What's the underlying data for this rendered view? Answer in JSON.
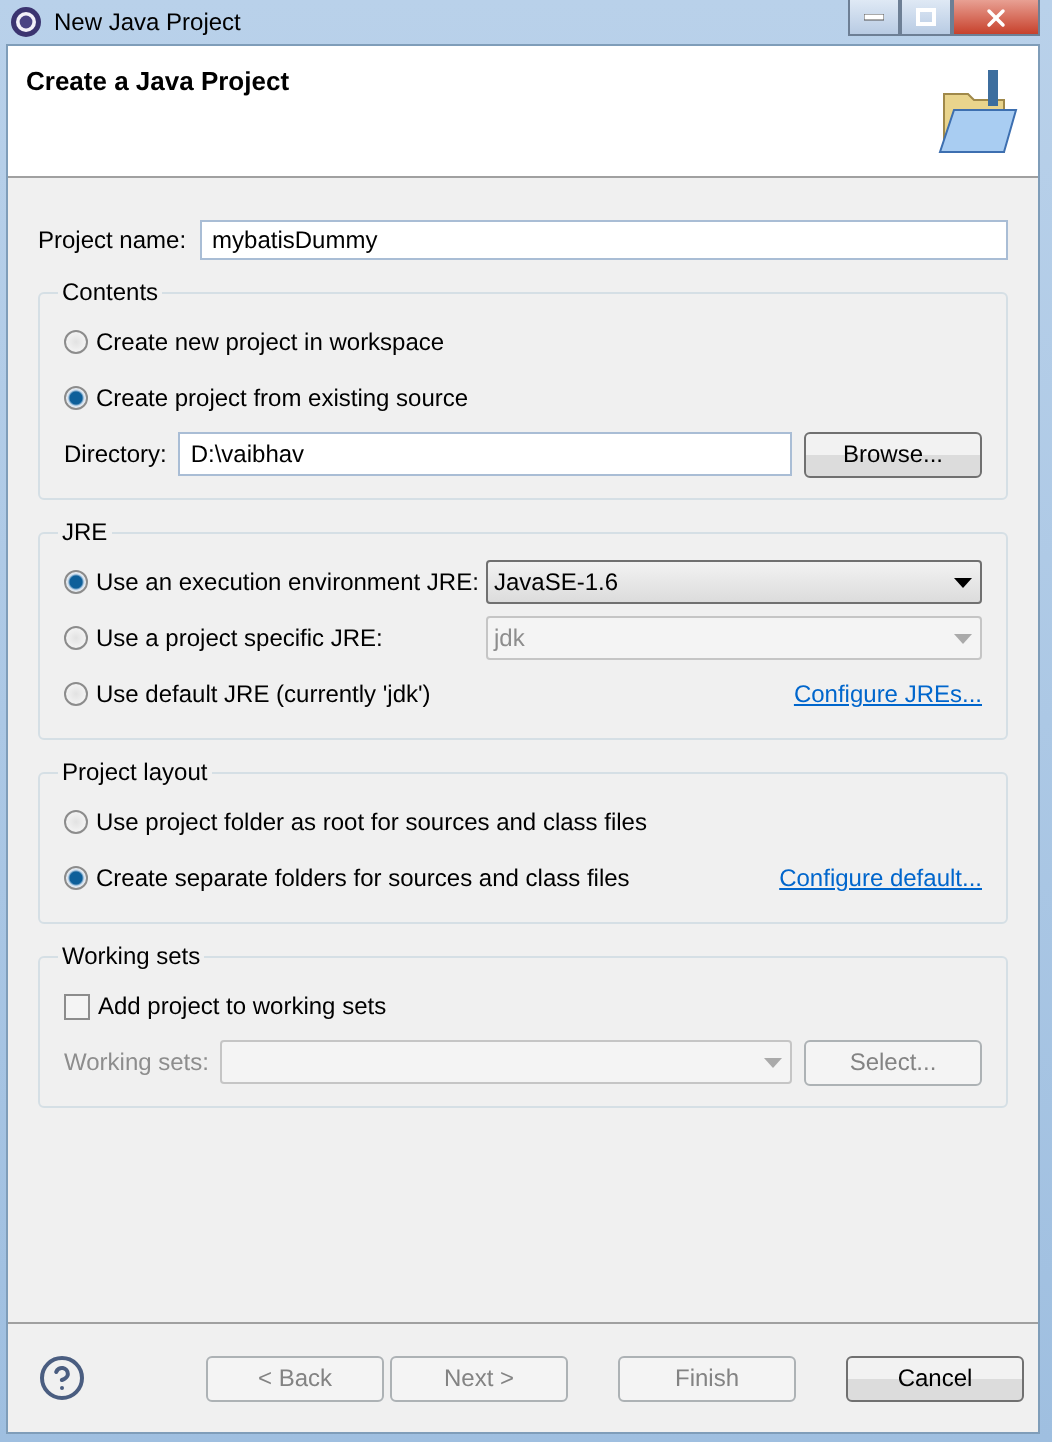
{
  "window": {
    "title": "New Java Project"
  },
  "banner": {
    "title": "Create a Java Project"
  },
  "project_name": {
    "label": "Project name:",
    "value": "mybatisDummy"
  },
  "groups": [
    {
      "title": "Contents",
      "rows": [
        {
          "kind": "radio",
          "label": "Create new project in workspace",
          "selected": false
        },
        {
          "kind": "radio",
          "label": "Create project from existing source",
          "selected": true
        },
        {
          "kind": "path",
          "label": "Directory:",
          "value": "D:\\vaibhav",
          "button": "Browse..."
        }
      ]
    },
    {
      "title": "JRE",
      "rows": [
        {
          "kind": "radio",
          "label": "Use an execution environment JRE:",
          "selected": true,
          "dropdown": {
            "value": "JavaSE-1.6",
            "disabled": false
          }
        },
        {
          "kind": "radio",
          "label": "Use a project specific JRE:",
          "selected": false,
          "dropdown": {
            "value": "jdk",
            "disabled": true
          }
        },
        {
          "kind": "radio",
          "label": "Use default JRE (currently 'jdk')",
          "selected": false,
          "link": "Configure JREs..."
        }
      ]
    },
    {
      "title": "Project layout",
      "rows": [
        {
          "kind": "radio",
          "label": "Use project folder as root for sources and class files",
          "selected": false
        },
        {
          "kind": "radio",
          "label": "Create separate folders for sources and class files",
          "selected": true,
          "link": "Configure default..."
        }
      ]
    },
    {
      "title": "Working sets",
      "rows": [
        {
          "kind": "checkbox",
          "label": "Add project to working sets",
          "checked": false
        },
        {
          "kind": "combo",
          "label": "Working sets:",
          "disabled": true,
          "button": "Select..."
        }
      ]
    }
  ],
  "buttons": [
    {
      "label": "< Back",
      "disabled": true
    },
    {
      "label": "Next >",
      "disabled": true
    },
    {
      "label": "Finish",
      "disabled": true
    },
    {
      "label": "Cancel",
      "disabled": false
    }
  ]
}
